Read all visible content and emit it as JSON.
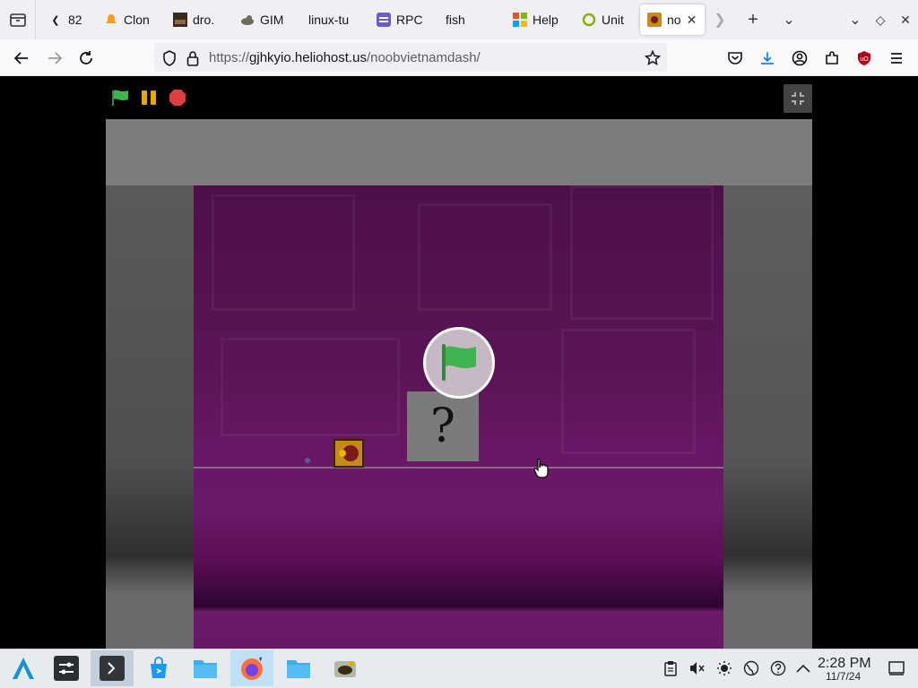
{
  "browser": {
    "tabs": [
      {
        "label": "82",
        "icon": "back-tab-arrow-icon"
      },
      {
        "label": "Clon",
        "icon": "bell-icon"
      },
      {
        "label": "dro.",
        "icon": "image-icon"
      },
      {
        "label": "GIM",
        "icon": "gimp-icon"
      },
      {
        "label": "linux-tu",
        "icon": "none"
      },
      {
        "label": "RPC",
        "icon": "rpc-icon"
      },
      {
        "label": "fish",
        "icon": "none"
      },
      {
        "label": "Help",
        "icon": "microsoft-icon"
      },
      {
        "label": "Unit",
        "icon": "unity-icon"
      },
      {
        "label": "no",
        "icon": "game-icon",
        "active": true
      }
    ],
    "url": {
      "scheme": "https://",
      "host": "gjhkyio.heliohost.us",
      "path": "/noobvietnamdash/"
    }
  },
  "game": {
    "controls": [
      "green-flag",
      "pause",
      "stop"
    ],
    "question_mark": "?",
    "colors": {
      "flag_green": "#3fb34f",
      "pause_yellow": "#e6a700",
      "stop_red": "#e0403d",
      "purple_bg": "#5a1556"
    }
  },
  "taskbar": {
    "apps": [
      "app-launcher-icon",
      "settings-icon",
      "terminal-icon",
      "store-icon",
      "file-manager-icon",
      "firefox-icon",
      "folder-icon",
      "coffee-icon"
    ],
    "time": "2:28 PM",
    "date": "11/7/24"
  }
}
